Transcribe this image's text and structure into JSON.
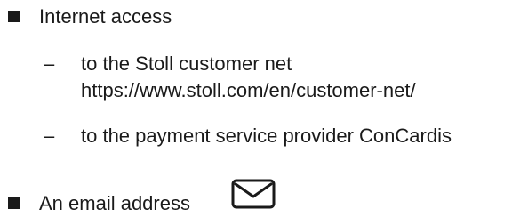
{
  "list": {
    "items": [
      {
        "label": "Internet access",
        "subitems": [
          {
            "line1": "to the Stoll customer net",
            "line2": "https://www.stoll.com/en/customer-net/"
          },
          {
            "line1": "to the payment service provider ConCardis"
          }
        ]
      },
      {
        "label": "An email address",
        "icon": "envelope-icon"
      }
    ],
    "dash": "–"
  }
}
